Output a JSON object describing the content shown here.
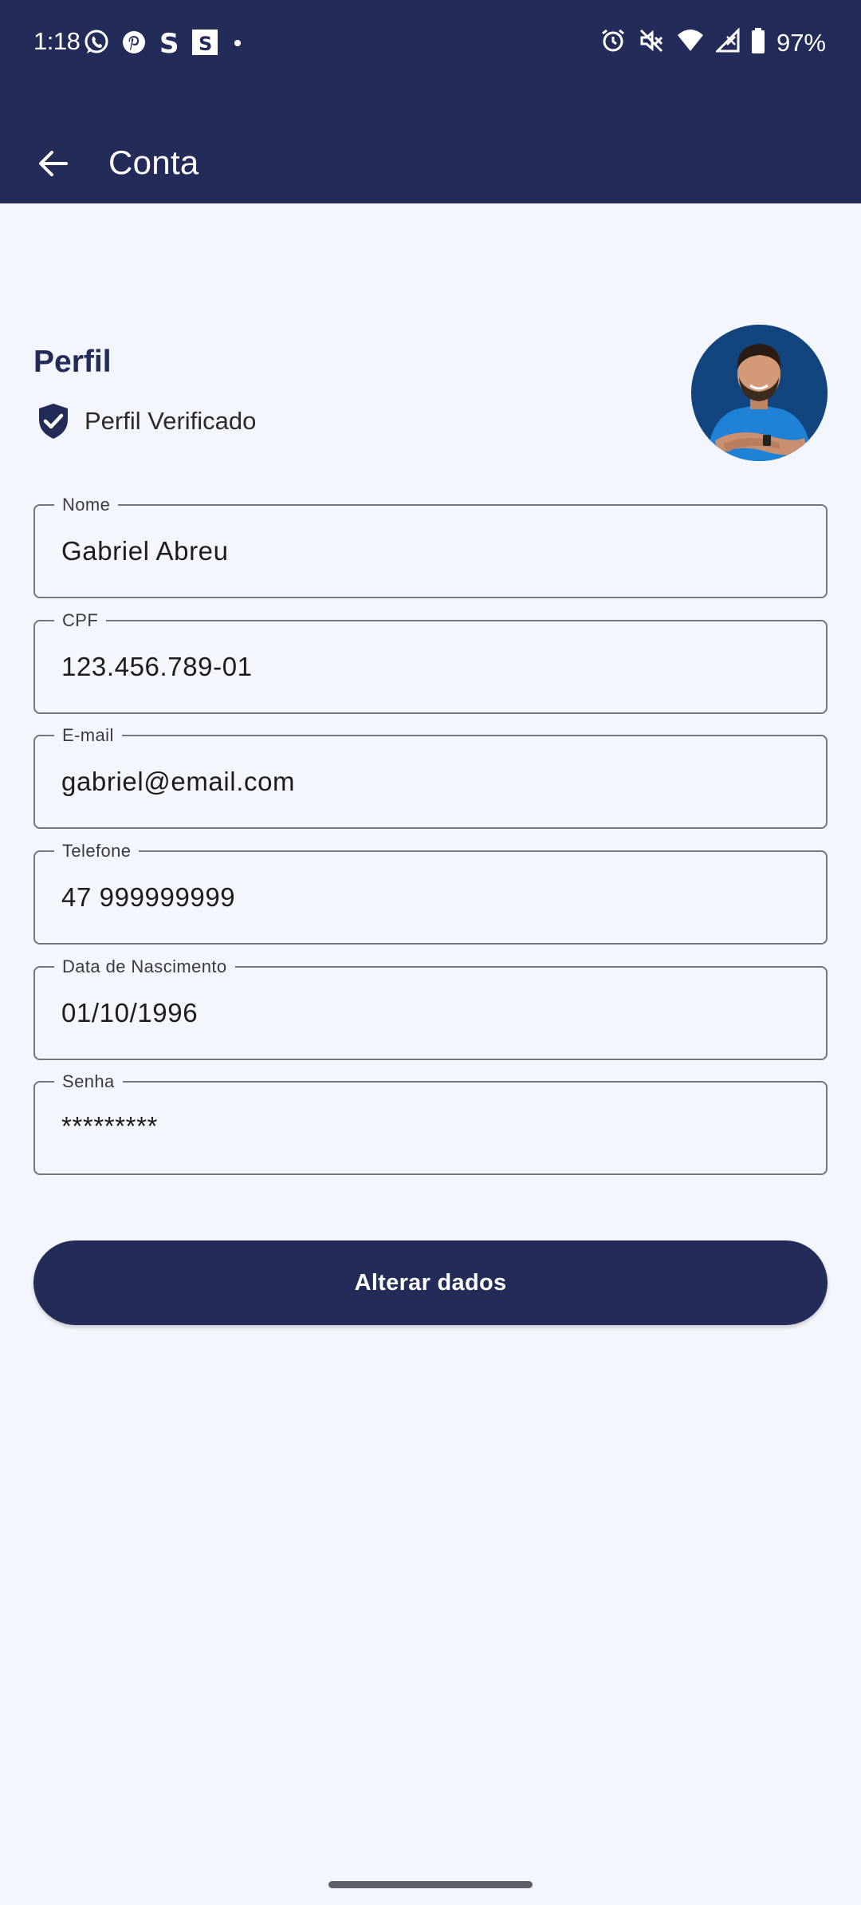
{
  "status_bar": {
    "time": "1:18",
    "battery": "97%",
    "left_icons": [
      "whatsapp-icon",
      "pinterest-icon",
      "s-app-icon",
      "s-square-icon",
      "dot-icon"
    ],
    "right_icons": [
      "alarm-icon",
      "mute-icon",
      "wifi-icon",
      "no-signal-icon",
      "battery-icon"
    ]
  },
  "appbar": {
    "title": "Conta",
    "back_icon": "arrow-left-icon"
  },
  "profile": {
    "title": "Perfil",
    "verified_label": "Perfil Verificado",
    "verified_icon": "shield-check-icon"
  },
  "fields": [
    {
      "label": "Nome",
      "value": "Gabriel Abreu"
    },
    {
      "label": "CPF",
      "value": "123.456.789-01"
    },
    {
      "label": "E-mail",
      "value": "gabriel@email.com"
    },
    {
      "label": "Telefone",
      "value": "47 999999999"
    },
    {
      "label": "Data de Nascimento",
      "value": "01/10/1996"
    },
    {
      "label": "Senha",
      "value": "*********"
    }
  ],
  "action": {
    "label": "Alterar dados"
  },
  "colors": {
    "primary": "#232b59",
    "background": "#f3f6fc",
    "outline": "#76777e"
  }
}
